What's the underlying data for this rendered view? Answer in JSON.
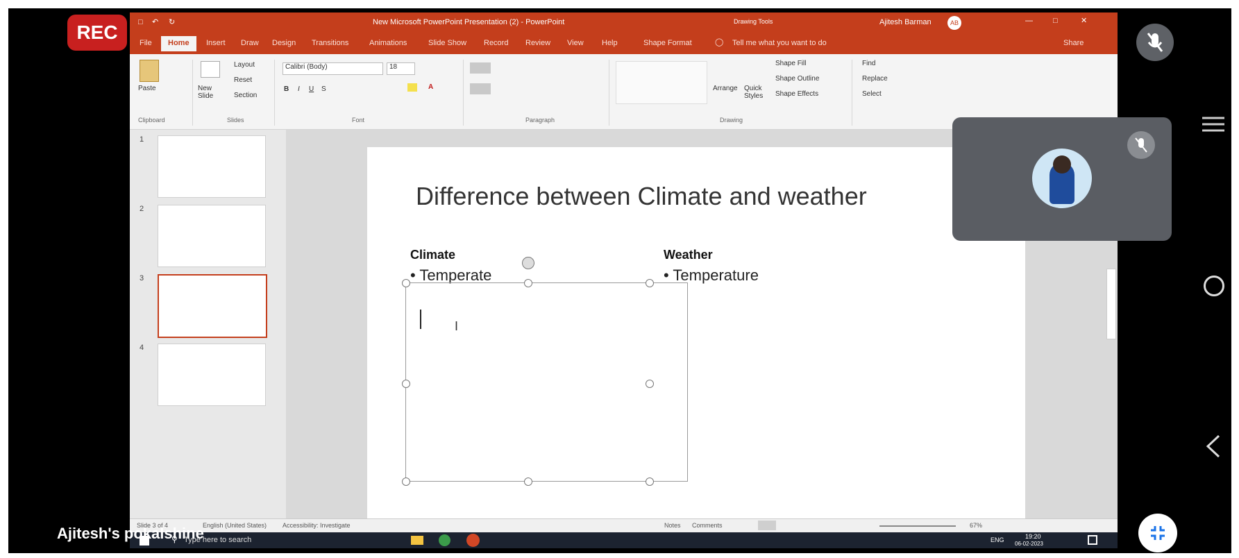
{
  "recording": {
    "label": "REC"
  },
  "presenter": {
    "name": "Ajitesh's pokalshine"
  },
  "powerpoint": {
    "window_title": "New Microsoft PowerPoint Presentation (2) - PowerPoint",
    "drawing_tools": "Drawing Tools",
    "user_name": "Ajitesh Barman",
    "user_initials": "AB",
    "tabs": [
      "File",
      "Home",
      "Insert",
      "Draw",
      "Design",
      "Transitions",
      "Animations",
      "Slide Show",
      "Record",
      "Review",
      "View",
      "Help",
      "Shape Format"
    ],
    "active_tab": "Home",
    "tell_me": "Tell me what you want to do",
    "share": "Share",
    "ribbon": {
      "clipboard": {
        "paste": "Paste",
        "label": "Clipboard"
      },
      "slides": {
        "new_slide": "New Slide",
        "layout": "Layout",
        "reset": "Reset",
        "section": "Section",
        "label": "Slides"
      },
      "font": {
        "font_name": "Calibri (Body)",
        "font_size": "18",
        "label": "Font"
      },
      "paragraph": {
        "label": "Paragraph"
      },
      "drawing": {
        "arrange": "Arrange",
        "quick_styles": "Quick Styles",
        "shape_fill": "Shape Fill",
        "shape_outline": "Shape Outline",
        "shape_effects": "Shape Effects",
        "label": "Drawing"
      },
      "editing": {
        "find": "Find",
        "replace": "Replace",
        "select": "Select"
      }
    },
    "thumbnails": [
      "1",
      "2",
      "3",
      "4"
    ],
    "slide": {
      "title": "Difference between Climate and weather",
      "left_header": "Climate",
      "left_bullet": "Temperate",
      "right_header": "Weather",
      "right_bullet": "Temperature"
    },
    "status": {
      "slide_of": "Slide 3 of 4",
      "language": "English (United States)",
      "accessibility": "Accessibility: Investigate",
      "notes": "Notes",
      "comments": "Comments",
      "zoom": "67%"
    },
    "taskbar": {
      "search_placeholder": "Type here to search",
      "lang": "ENG",
      "time": "19:20",
      "date": "06-02-2023"
    }
  }
}
